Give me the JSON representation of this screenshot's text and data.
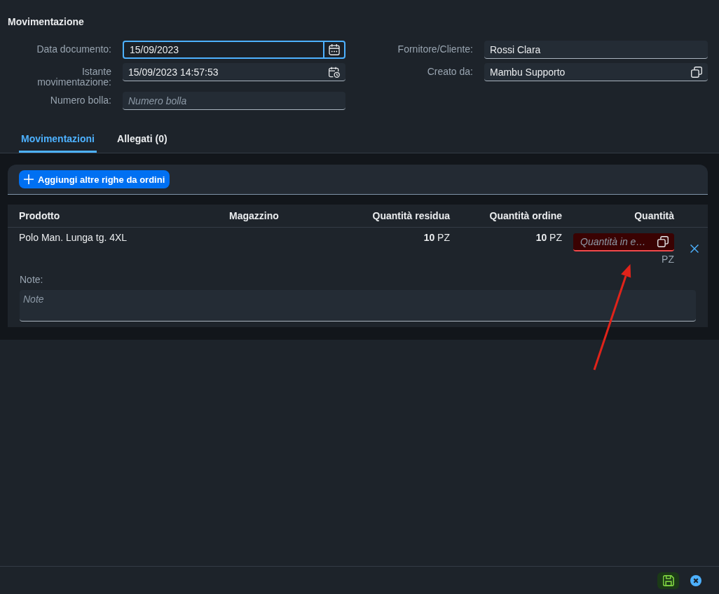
{
  "title": "Movimentazione",
  "form": {
    "left": [
      {
        "label": "Data documento:",
        "value": "15/09/2023",
        "kind": "date",
        "focused": true
      },
      {
        "label": "Istante movimentazione:",
        "value": "15/09/2023 14:57:53",
        "kind": "datetime",
        "focused": false
      },
      {
        "label": "Numero bolla:",
        "placeholder": "Numero bolla",
        "kind": "text",
        "focused": false
      }
    ],
    "right": [
      {
        "label": "Fornitore/Cliente:",
        "value": "Rossi Clara",
        "kind": "text",
        "focused": false
      },
      {
        "label": "Creato da:",
        "value": "Mambu Supporto",
        "kind": "copy",
        "focused": false
      }
    ]
  },
  "tabs": [
    {
      "label": "Movimentazioni",
      "selected": true
    },
    {
      "label": "Allegati (0)",
      "selected": false
    }
  ],
  "toolbar": {
    "add_button": "Aggiungi altre righe da ordini"
  },
  "table": {
    "columns": [
      "Prodotto",
      "Magazzino",
      "Quantità residua",
      "Quantità ordine",
      "Quantità"
    ],
    "rows": [
      {
        "product": "Polo Man. Lunga tg. 4XL",
        "remaining": "**10** PZ",
        "ordered": "**10** PZ",
        "quantity": {
          "placeholder": "Quantità in e…",
          "unit": "PZ",
          "error": true
        },
        "notes_label": "Note:",
        "notes": {
          "placeholder": "Note"
        }
      }
    ]
  },
  "annotations": [
    {
      "kind": "arrow"
    }
  ],
  "footer": {
    "actions": [
      {
        "kind": "save"
      },
      {
        "kind": "cancel"
      }
    ]
  }
}
